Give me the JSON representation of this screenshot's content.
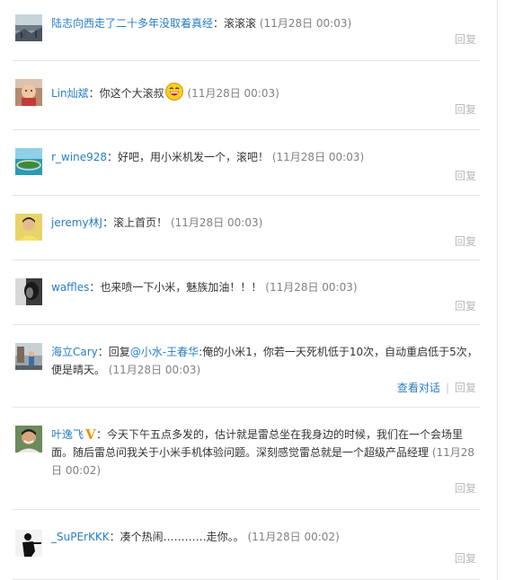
{
  "comments": [
    {
      "user": "陆志向西走了二十多年没取着真经",
      "sep": "：",
      "text": "滚滚滚",
      "time": "(11月28日 00:03)",
      "reply": "回复",
      "avatar": "landscape-avatar"
    },
    {
      "user": "Lin灿斌",
      "sep": "：",
      "text": "你这个大滚叔",
      "emoji": "laughing-emoji-icon",
      "time": "(11月28日 00:03)",
      "reply": "回复",
      "avatar": "child-avatar"
    },
    {
      "user": "r_wine928",
      "sep": "：",
      "text": "好吧，用小米机发一个，滚吧！",
      "time": "(11月28日 00:03)",
      "reply": "回复",
      "avatar": "island-avatar"
    },
    {
      "user": "jeremy林J",
      "sep": "：",
      "text": "滚上首页！",
      "time": "(11月28日 00:03)",
      "reply": "回复",
      "avatar": "person-yellow-avatar"
    },
    {
      "user": "waffles",
      "sep": "：",
      "text": "也来喷一下小米，魅族加油！！！",
      "time": "(11月28日 00:03)",
      "reply": "回复",
      "avatar": "dark-portrait-avatar"
    },
    {
      "user": "海立Cary",
      "sep": "：",
      "pre": "回复",
      "mention": "@小水-王春华",
      "text": ":俺的小米1，你若一天死机低于10次，自动重启低于5次，便是晴天。",
      "time": "(11月28日 00:03)",
      "conversation": "查看对话",
      "divider": "|",
      "reply": "回复",
      "avatar": "street-avatar"
    },
    {
      "user": "叶逸飞",
      "verified": "V",
      "sep": "：",
      "text": "今天下午五点多发的，估计就是雷总坐在我身边的时候，我们在一个会场里面。随后雷总问我关于小米手机体验问题。深刻感觉雷总就是一个超级产品经理",
      "time": "(11月28日 00:02)",
      "reply": "回复",
      "avatar": "man-avatar"
    },
    {
      "user": "_SuPErKKK",
      "sep": "：",
      "text": "凑个热闹…………走你。。",
      "time": "(11月28日 00:02)",
      "reply": "回复",
      "avatar": "silhouette-avatar"
    }
  ]
}
